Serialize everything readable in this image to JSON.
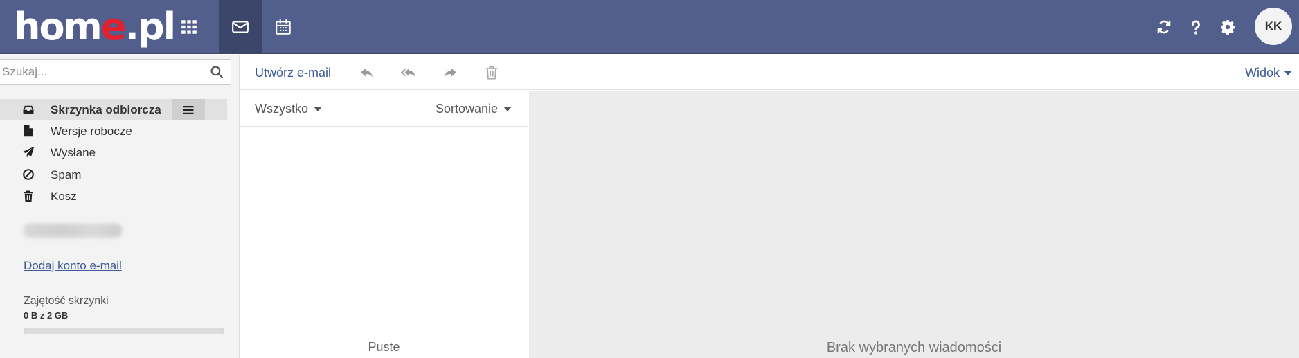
{
  "brand": {
    "logo_part1": "hom",
    "logo_accent": "e",
    "logo_part2": ".pl",
    "accent_color": "#e5202e",
    "bar_color": "#525f8c"
  },
  "topnav": [
    {
      "name": "apps-icon",
      "active": false
    },
    {
      "name": "mail-icon",
      "active": true
    },
    {
      "name": "calendar-icon",
      "active": false
    }
  ],
  "top_tools": [
    "refresh-icon",
    "help-icon",
    "settings-icon"
  ],
  "user": {
    "initials": "KK"
  },
  "search": {
    "placeholder": "Szukaj...",
    "value": ""
  },
  "folders": [
    {
      "label": "Skrzynka odbiorcza",
      "icon": "inbox-icon",
      "active": true
    },
    {
      "label": "Wersje robocze",
      "icon": "file-icon",
      "active": false
    },
    {
      "label": "Wysłane",
      "icon": "paper-plane-icon",
      "active": false
    },
    {
      "label": "Spam",
      "icon": "ban-icon",
      "active": false
    },
    {
      "label": "Kosz",
      "icon": "trash-icon",
      "active": false
    }
  ],
  "sidebar": {
    "add_account": "Dodaj konto e-mail",
    "quota_label": "Zajętość skrzynki",
    "quota_value": "0 B z 2 GB",
    "quota_used_fraction": 0
  },
  "toolbar": {
    "compose": "Utwórz e-mail",
    "actions": [
      "reply-icon",
      "reply-all-icon",
      "forward-icon",
      "delete-icon"
    ],
    "view": "Widok"
  },
  "list": {
    "filter": "Wszystko",
    "sort": "Sortowanie",
    "empty": "Puste"
  },
  "preview": {
    "empty": "Brak wybranych wiadomości"
  }
}
